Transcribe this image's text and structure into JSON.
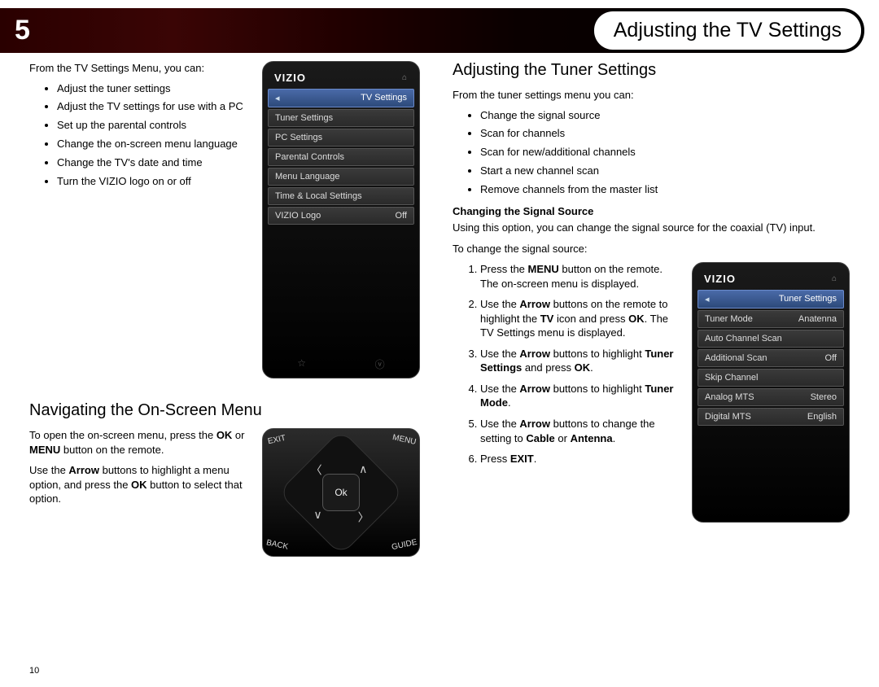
{
  "header": {
    "chapter_number": "5",
    "title": "Adjusting the TV Settings"
  },
  "page_number": "10",
  "left": {
    "intro": "From the TV Settings Menu, you can:",
    "bullets": [
      "Adjust the tuner settings",
      "Adjust the TV settings for use with a PC",
      "Set up the parental controls",
      "Change the on-screen menu language",
      "Change the TV's date and time",
      "Turn the VIZIO logo on or off"
    ],
    "nav_heading": "Navigating the On-Screen Menu",
    "nav_p1_a": "To open the on-screen menu, press the ",
    "nav_p1_ok": "OK",
    "nav_p1_b": " or ",
    "nav_p1_menu": "MENU",
    "nav_p1_c": " button on the remote.",
    "nav_p2_a": "Use the ",
    "nav_p2_arrow": "Arrow",
    "nav_p2_b": " buttons to highlight a menu option, and press the ",
    "nav_p2_ok": "OK",
    "nav_p2_c": " button to select that option."
  },
  "tv_menu": {
    "brand": "VIZIO",
    "title": "TV Settings",
    "items": [
      {
        "label": "Tuner Settings",
        "value": ""
      },
      {
        "label": "PC Settings",
        "value": ""
      },
      {
        "label": "Parental Controls",
        "value": ""
      },
      {
        "label": "Menu Language",
        "value": ""
      },
      {
        "label": "Time & Local Settings",
        "value": ""
      },
      {
        "label": "VIZIO Logo",
        "value": "Off"
      }
    ]
  },
  "remote": {
    "ok": "Ok",
    "corners": {
      "tl": "EXIT",
      "tr": "MENU",
      "bl": "BACK",
      "br": "GUIDE"
    },
    "arrows": {
      "up": "∧",
      "down": "∨",
      "left": "〈",
      "right": "〉"
    }
  },
  "right": {
    "heading": "Adjusting the Tuner Settings",
    "intro": "From the tuner settings menu you can:",
    "bullets": [
      "Change the signal source",
      "Scan for channels",
      "Scan for new/additional channels",
      "Start a new channel scan",
      "Remove channels from the master list"
    ],
    "sub_heading": "Changing the Signal Source",
    "sub_p1": "Using this option, you can change the signal source for the coaxial (TV) input.",
    "sub_p2": "To change the signal source:",
    "steps": {
      "s1a": "Press the ",
      "s1b": "MENU",
      "s1c": " button on the remote. The on-screen menu is displayed.",
      "s2a": "Use the ",
      "s2b": "Arrow",
      "s2c": " buttons on the remote to highlight the ",
      "s2d": "TV",
      "s2e": " icon and press ",
      "s2f": "OK",
      "s2g": ". The TV Settings menu is displayed.",
      "s3a": "Use the ",
      "s3b": "Arrow",
      "s3c": " buttons to highlight ",
      "s3d": "Tuner Settings",
      "s3e": " and press ",
      "s3f": "OK",
      "s3g": ".",
      "s4a": "Use the ",
      "s4b": "Arrow",
      "s4c": " buttons to highlight ",
      "s4d": "Tuner Mode",
      "s4e": ".",
      "s5a": "Use the ",
      "s5b": "Arrow",
      "s5c": " buttons to change the setting to ",
      "s5d": "Cable",
      "s5e": " or ",
      "s5f": "Antenna",
      "s5g": ".",
      "s6a": "Press ",
      "s6b": "EXIT",
      "s6c": "."
    }
  },
  "tuner_menu": {
    "brand": "VIZIO",
    "title": "Tuner Settings",
    "items": [
      {
        "label": "Tuner Mode",
        "value": "Anatenna"
      },
      {
        "label": "Auto Channel Scan",
        "value": ""
      },
      {
        "label": "Additional Scan",
        "value": "Off"
      },
      {
        "label": "Skip Channel",
        "value": ""
      },
      {
        "label": "Analog MTS",
        "value": "Stereo"
      },
      {
        "label": "Digital MTS",
        "value": "English"
      }
    ]
  }
}
